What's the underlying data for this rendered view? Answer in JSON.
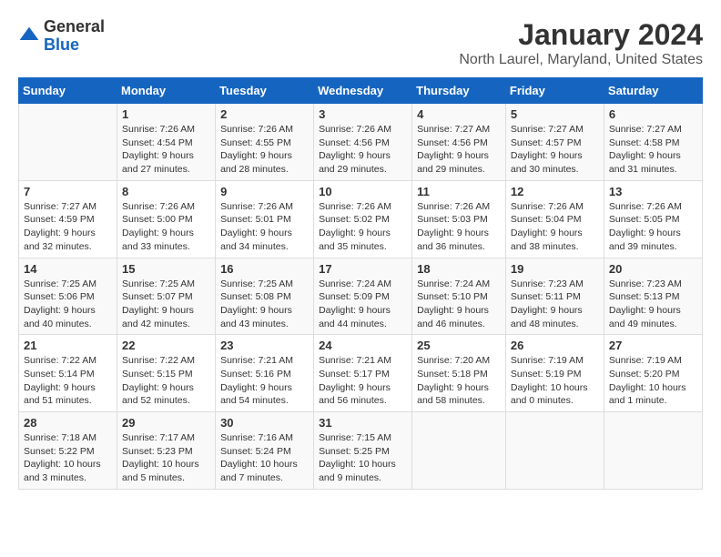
{
  "header": {
    "logo_line1": "General",
    "logo_line2": "Blue",
    "title": "January 2024",
    "subtitle": "North Laurel, Maryland, United States"
  },
  "calendar": {
    "days_of_week": [
      "Sunday",
      "Monday",
      "Tuesday",
      "Wednesday",
      "Thursday",
      "Friday",
      "Saturday"
    ],
    "rows": [
      [
        {
          "day": "",
          "info": ""
        },
        {
          "day": "1",
          "info": "Sunrise: 7:26 AM\nSunset: 4:54 PM\nDaylight: 9 hours\nand 27 minutes."
        },
        {
          "day": "2",
          "info": "Sunrise: 7:26 AM\nSunset: 4:55 PM\nDaylight: 9 hours\nand 28 minutes."
        },
        {
          "day": "3",
          "info": "Sunrise: 7:26 AM\nSunset: 4:56 PM\nDaylight: 9 hours\nand 29 minutes."
        },
        {
          "day": "4",
          "info": "Sunrise: 7:27 AM\nSunset: 4:56 PM\nDaylight: 9 hours\nand 29 minutes."
        },
        {
          "day": "5",
          "info": "Sunrise: 7:27 AM\nSunset: 4:57 PM\nDaylight: 9 hours\nand 30 minutes."
        },
        {
          "day": "6",
          "info": "Sunrise: 7:27 AM\nSunset: 4:58 PM\nDaylight: 9 hours\nand 31 minutes."
        }
      ],
      [
        {
          "day": "7",
          "info": "Sunrise: 7:27 AM\nSunset: 4:59 PM\nDaylight: 9 hours\nand 32 minutes."
        },
        {
          "day": "8",
          "info": "Sunrise: 7:26 AM\nSunset: 5:00 PM\nDaylight: 9 hours\nand 33 minutes."
        },
        {
          "day": "9",
          "info": "Sunrise: 7:26 AM\nSunset: 5:01 PM\nDaylight: 9 hours\nand 34 minutes."
        },
        {
          "day": "10",
          "info": "Sunrise: 7:26 AM\nSunset: 5:02 PM\nDaylight: 9 hours\nand 35 minutes."
        },
        {
          "day": "11",
          "info": "Sunrise: 7:26 AM\nSunset: 5:03 PM\nDaylight: 9 hours\nand 36 minutes."
        },
        {
          "day": "12",
          "info": "Sunrise: 7:26 AM\nSunset: 5:04 PM\nDaylight: 9 hours\nand 38 minutes."
        },
        {
          "day": "13",
          "info": "Sunrise: 7:26 AM\nSunset: 5:05 PM\nDaylight: 9 hours\nand 39 minutes."
        }
      ],
      [
        {
          "day": "14",
          "info": "Sunrise: 7:25 AM\nSunset: 5:06 PM\nDaylight: 9 hours\nand 40 minutes."
        },
        {
          "day": "15",
          "info": "Sunrise: 7:25 AM\nSunset: 5:07 PM\nDaylight: 9 hours\nand 42 minutes."
        },
        {
          "day": "16",
          "info": "Sunrise: 7:25 AM\nSunset: 5:08 PM\nDaylight: 9 hours\nand 43 minutes."
        },
        {
          "day": "17",
          "info": "Sunrise: 7:24 AM\nSunset: 5:09 PM\nDaylight: 9 hours\nand 44 minutes."
        },
        {
          "day": "18",
          "info": "Sunrise: 7:24 AM\nSunset: 5:10 PM\nDaylight: 9 hours\nand 46 minutes."
        },
        {
          "day": "19",
          "info": "Sunrise: 7:23 AM\nSunset: 5:11 PM\nDaylight: 9 hours\nand 48 minutes."
        },
        {
          "day": "20",
          "info": "Sunrise: 7:23 AM\nSunset: 5:13 PM\nDaylight: 9 hours\nand 49 minutes."
        }
      ],
      [
        {
          "day": "21",
          "info": "Sunrise: 7:22 AM\nSunset: 5:14 PM\nDaylight: 9 hours\nand 51 minutes."
        },
        {
          "day": "22",
          "info": "Sunrise: 7:22 AM\nSunset: 5:15 PM\nDaylight: 9 hours\nand 52 minutes."
        },
        {
          "day": "23",
          "info": "Sunrise: 7:21 AM\nSunset: 5:16 PM\nDaylight: 9 hours\nand 54 minutes."
        },
        {
          "day": "24",
          "info": "Sunrise: 7:21 AM\nSunset: 5:17 PM\nDaylight: 9 hours\nand 56 minutes."
        },
        {
          "day": "25",
          "info": "Sunrise: 7:20 AM\nSunset: 5:18 PM\nDaylight: 9 hours\nand 58 minutes."
        },
        {
          "day": "26",
          "info": "Sunrise: 7:19 AM\nSunset: 5:19 PM\nDaylight: 10 hours\nand 0 minutes."
        },
        {
          "day": "27",
          "info": "Sunrise: 7:19 AM\nSunset: 5:20 PM\nDaylight: 10 hours\nand 1 minute."
        }
      ],
      [
        {
          "day": "28",
          "info": "Sunrise: 7:18 AM\nSunset: 5:22 PM\nDaylight: 10 hours\nand 3 minutes."
        },
        {
          "day": "29",
          "info": "Sunrise: 7:17 AM\nSunset: 5:23 PM\nDaylight: 10 hours\nand 5 minutes."
        },
        {
          "day": "30",
          "info": "Sunrise: 7:16 AM\nSunset: 5:24 PM\nDaylight: 10 hours\nand 7 minutes."
        },
        {
          "day": "31",
          "info": "Sunrise: 7:15 AM\nSunset: 5:25 PM\nDaylight: 10 hours\nand 9 minutes."
        },
        {
          "day": "",
          "info": ""
        },
        {
          "day": "",
          "info": ""
        },
        {
          "day": "",
          "info": ""
        }
      ]
    ]
  }
}
